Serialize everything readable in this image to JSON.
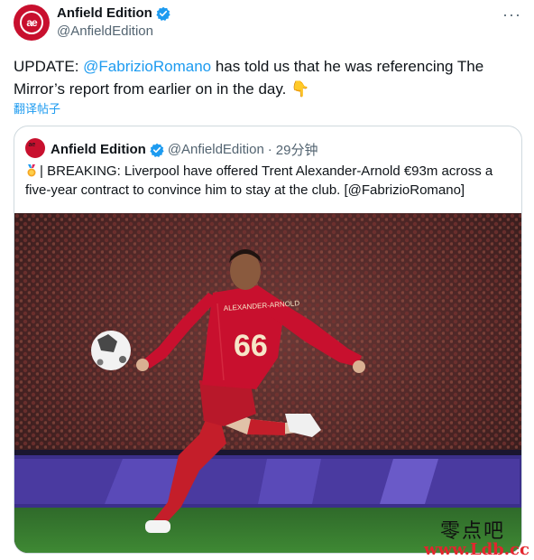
{
  "author": {
    "display_name": "Anfield Edition",
    "handle": "@AnfieldEdition",
    "avatar_text": "ae"
  },
  "menu": {
    "more_label": "···"
  },
  "tweet": {
    "prefix": "UPDATE: ",
    "mention": "@FabrizioRomano",
    "suffix": " has told us that he was referencing The Mirror’s report from earlier on in the day.",
    "emoji": "👇",
    "translate_label": "翻译帖子"
  },
  "quoted": {
    "display_name": "Anfield Edition",
    "handle": "@AnfieldEdition",
    "separator": "·",
    "time": "29分钟",
    "text": "| BREAKING: Liverpool have offered Trent Alexander-Arnold €93m across a five-year contract to convince him to stay at the club. [@FabrizioRomano]",
    "jersey_number": "66",
    "jersey_name": "ALEXANDER-ARNOLD"
  },
  "watermark": {
    "site_name": "零点吧",
    "url": "www.Ldb.cc"
  },
  "colors": {
    "accent": "#1d9bf0",
    "liverpool_red": "#c8102e",
    "text": "#0f1419",
    "muted": "#536471"
  }
}
